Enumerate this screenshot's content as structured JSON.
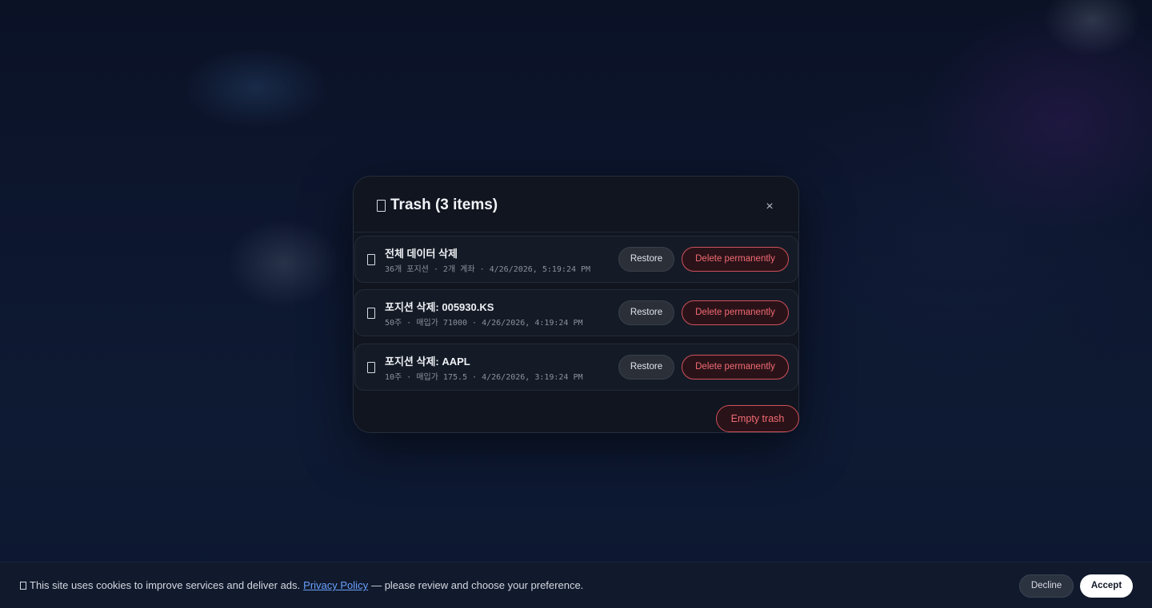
{
  "modal": {
    "title": "Trash (3 items)",
    "title_icon": "trash-icon",
    "close_label": "×",
    "items": [
      {
        "title": "전체 데이터 삭제",
        "meta": "36개 포지션 · 2개 계좌 · 4/26/2026, 5:19:24 PM",
        "icon": "trash-icon",
        "restore_label": "Restore",
        "delete_label": "Delete permanently"
      },
      {
        "title": "포지션 삭제: 005930.KS",
        "meta": "50주 · 매입가 71000 · 4/26/2026, 4:19:24 PM",
        "icon": "trash-icon",
        "restore_label": "Restore",
        "delete_label": "Delete permanently"
      },
      {
        "title": "포지션 삭제: AAPL",
        "meta": "10주 · 매입가 175.5 · 4/26/2026, 3:19:24 PM",
        "icon": "trash-icon",
        "restore_label": "Restore",
        "delete_label": "Delete permanently"
      }
    ],
    "empty_label": "Empty trash"
  },
  "cookie": {
    "icon": "cookie-icon",
    "text_before": "This site uses cookies to improve services and deliver ads.",
    "link_label": "Privacy Policy",
    "text_after": "— please review and choose your preference.",
    "decline_label": "Decline",
    "accept_label": "Accept"
  },
  "colors": {
    "danger": "#f26a74",
    "link": "#6aa0ff",
    "modal_bg": "#10151f"
  }
}
